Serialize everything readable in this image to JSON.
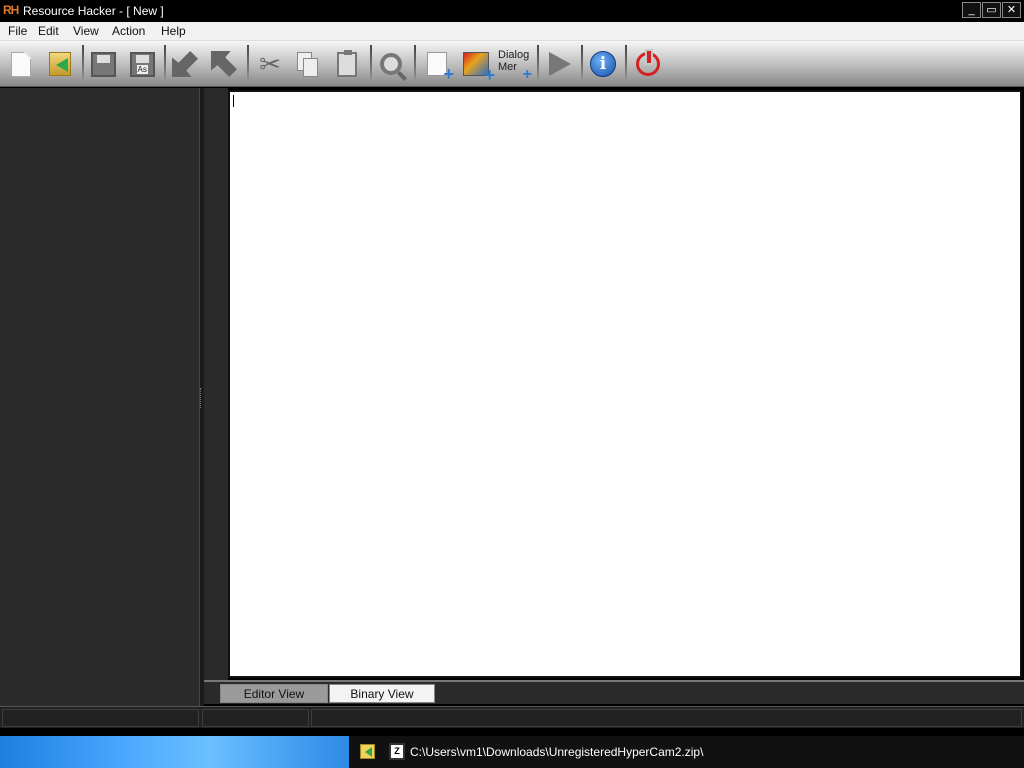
{
  "window": {
    "logo": "RH",
    "title": "Resource Hacker - [ New ]",
    "controls": {
      "minimize": "_",
      "maximize": "▭",
      "close": "✕"
    }
  },
  "menu": {
    "items": [
      {
        "label": "File"
      },
      {
        "label": "Edit"
      },
      {
        "label": "View"
      },
      {
        "label": "Action"
      },
      {
        "label": "Help"
      }
    ]
  },
  "toolbar": {
    "dialog_label_line1": "Dialog",
    "dialog_label_line2": "Mer",
    "info_glyph": "i",
    "saveas_badge": "As",
    "buttons": [
      "new-file-icon",
      "open-file-icon",
      "save-icon",
      "save-as-icon",
      "import-arrow-icon",
      "export-arrow-icon",
      "cut-icon",
      "copy-icon",
      "paste-icon",
      "search-icon",
      "add-resource-icon",
      "add-image-icon",
      "dialog-merger-icon",
      "compile-run-icon",
      "info-icon",
      "power-icon"
    ]
  },
  "editor": {
    "tabs": [
      {
        "label": "Editor View",
        "active": false
      },
      {
        "label": "Binary View",
        "active": true
      }
    ]
  },
  "taskbar": {
    "zip_badge": "Z",
    "path": "C:\\Users\\vm1\\Downloads\\UnregisteredHyperCam2.zip\\"
  }
}
